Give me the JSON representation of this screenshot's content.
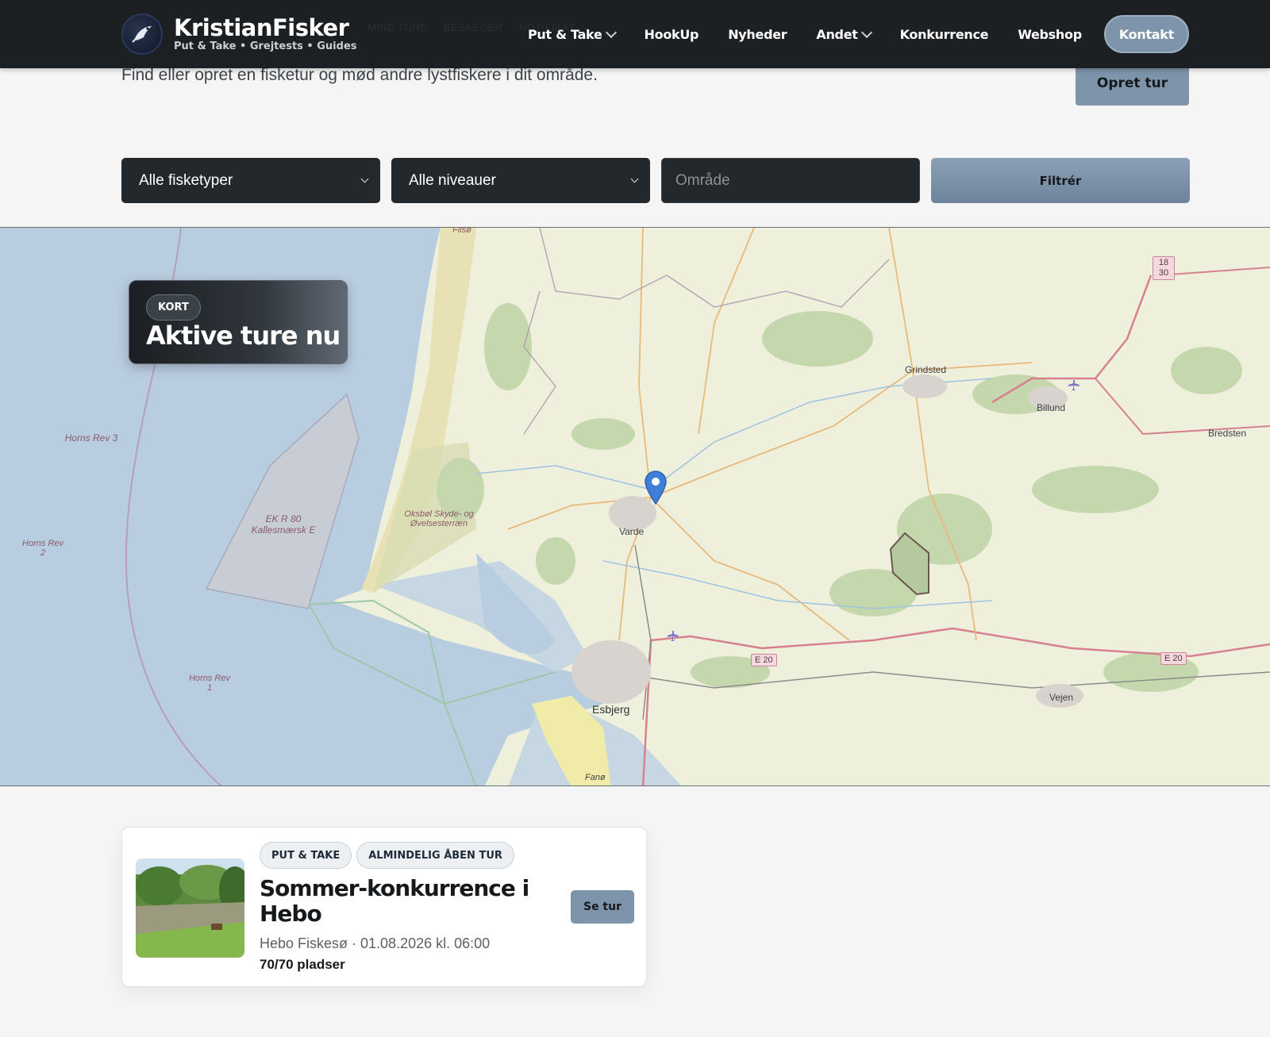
{
  "header": {
    "brand_name": "KristianFisker",
    "brand_tagline": "Put & Take • Grejtests • Guides",
    "background_links": [
      "MINE TURE",
      "BESKEDER",
      "NOTIFIKAT"
    ],
    "nav": [
      {
        "label": "Put & Take",
        "has_dropdown": true
      },
      {
        "label": "HookUp",
        "has_dropdown": false
      },
      {
        "label": "Nyheder",
        "has_dropdown": false
      },
      {
        "label": "Andet",
        "has_dropdown": true
      },
      {
        "label": "Konkurrence",
        "has_dropdown": false
      },
      {
        "label": "Webshop",
        "has_dropdown": false
      }
    ],
    "contact_label": "Kontakt"
  },
  "hero": {
    "subtitle": "Find eller opret en fisketur og mød andre lystfiskere i dit område.",
    "create_button": "Opret tur"
  },
  "filters": {
    "fishing_type": "Alle fisketyper",
    "level": "Alle niveauer",
    "area_placeholder": "Område",
    "submit_label": "Filtrér"
  },
  "map": {
    "badge": "KORT",
    "title": "Aktive ture nu",
    "labels": {
      "horns_rev_3": "Horns Rev 3",
      "horns_rev_2": "Horns Rev 2",
      "horns_rev_1": "Horns Rev 1",
      "ek_r_80": "EK R 80 Kallesmærsk E",
      "oksbol": "Oksbøl Skyde- og Øvelsesterræn",
      "varde": "Varde",
      "esbjerg": "Esbjerg",
      "fano": "Fanø",
      "grindsted": "Grindsted",
      "billund": "Billund",
      "bredsten": "Bredsten",
      "vejen": "Vejen",
      "filsoe": "Filsø",
      "e20_a": "E 20",
      "e20_b": "E 20",
      "route_18_30": "18 30"
    }
  },
  "trips": [
    {
      "tags": [
        "PUT & TAKE",
        "ALMINDELIG ÅBEN TUR"
      ],
      "title": "Sommer-konkurrence i Hebo",
      "meta": "Hebo Fiskesø · 01.08.2026 kl. 06:00",
      "seats": "70/70 pladser",
      "button": "Se tur"
    }
  ],
  "colors": {
    "header_bg": "#1d2023",
    "accent": "#7e94aa",
    "sea": "#b9cde0",
    "land": "#eef0dc"
  }
}
